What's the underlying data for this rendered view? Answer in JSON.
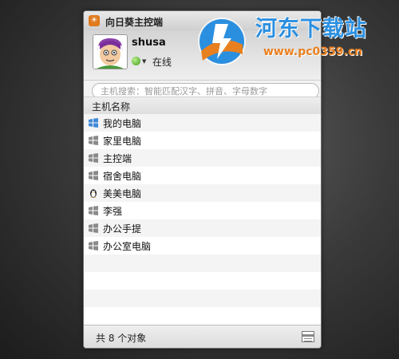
{
  "window": {
    "title": "向日葵主控端"
  },
  "profile": {
    "username": "shusa",
    "status": "在线"
  },
  "search": {
    "placeholder": "主机搜索：智能匹配汉字、拼音、字母数字"
  },
  "list": {
    "column_header": "主机名称",
    "items": [
      {
        "label": "我的电脑",
        "icon": "windows-icon-blue"
      },
      {
        "label": "家里电脑",
        "icon": "windows-icon-gray"
      },
      {
        "label": "主控端",
        "icon": "windows-icon-gray"
      },
      {
        "label": "宿舍电脑",
        "icon": "windows-icon-gray"
      },
      {
        "label": "美美电脑",
        "icon": "linux-penguin-icon"
      },
      {
        "label": "李强",
        "icon": "windows-icon-gray"
      },
      {
        "label": "办公手提",
        "icon": "windows-icon-gray"
      },
      {
        "label": "办公室电脑",
        "icon": "windows-icon-gray"
      }
    ]
  },
  "footer": {
    "count_text": "共 8 个对象"
  },
  "watermark": {
    "title": "河东下载站",
    "url": "www.pc0359.cn"
  },
  "colors": {
    "accent_blue": "#2b8fe0",
    "accent_orange": "#e9801f",
    "app_icon": "#e07a1c",
    "status_green": "#3d9a1a"
  }
}
